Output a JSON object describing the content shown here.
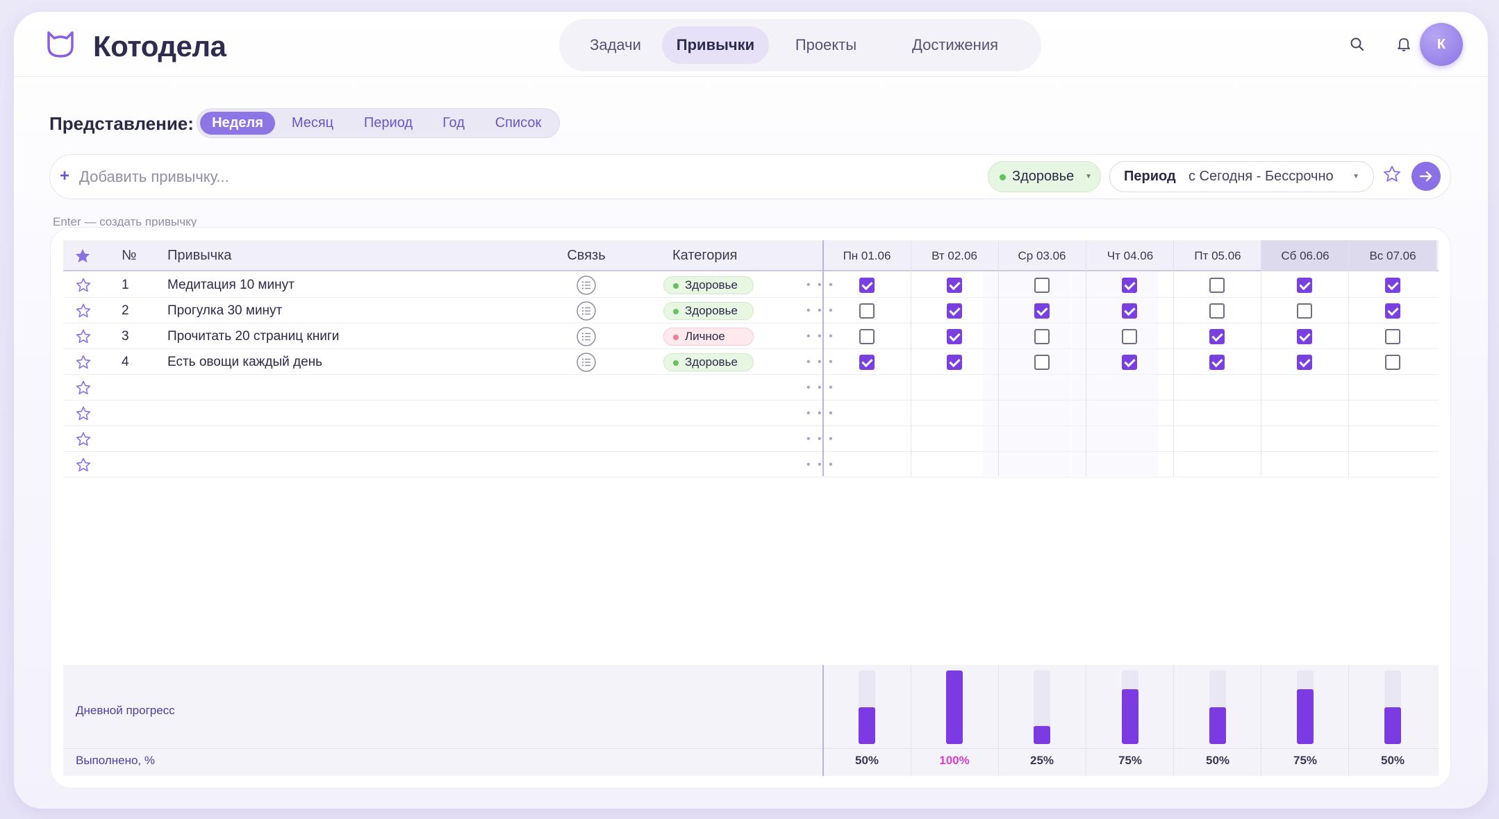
{
  "app": {
    "title": "Котодела"
  },
  "nav": [
    {
      "label": "Задачи",
      "active": false
    },
    {
      "label": "Привычки",
      "active": true
    },
    {
      "label": "Проекты",
      "active": false
    },
    {
      "label": "Достижения",
      "active": false
    }
  ],
  "header": {
    "avatar_initial": "К",
    "icons": [
      "search-icon",
      "bell-icon"
    ]
  },
  "view": {
    "label": "Представление:",
    "tabs": [
      {
        "label": "Неделя",
        "active": true
      },
      {
        "label": "Месяц",
        "active": false
      },
      {
        "label": "Период",
        "active": false
      },
      {
        "label": "Год",
        "active": false
      },
      {
        "label": "Список",
        "active": false
      }
    ]
  },
  "addbar": {
    "plus": "+",
    "placeholder": "Добавить привычку...",
    "category": "Здоровье",
    "period_label": "Период",
    "period_value": "с Сегодня - Бессрочно",
    "hint": "Enter — создать привычку"
  },
  "table": {
    "headers": {
      "num": "№",
      "habit": "Привычка",
      "link": "Связь",
      "category": "Категория"
    },
    "days": [
      {
        "label": "Пн 01.06",
        "weekend": false
      },
      {
        "label": "Вт 02.06",
        "weekend": false
      },
      {
        "label": "Ср 03.06",
        "weekend": false
      },
      {
        "label": "Чт 04.06",
        "weekend": false
      },
      {
        "label": "Пт 05.06",
        "weekend": false
      },
      {
        "label": "Сб 06.06",
        "weekend": true
      },
      {
        "label": "Вс 07.06",
        "weekend": true
      }
    ],
    "rows": [
      {
        "num": "1",
        "name": "Медитация 10 минут",
        "category": "Здоровье",
        "category_color": "green",
        "checks": [
          true,
          true,
          false,
          true,
          false,
          true,
          true
        ]
      },
      {
        "num": "2",
        "name": "Прогулка 30 минут",
        "category": "Здоровье",
        "category_color": "green",
        "checks": [
          false,
          true,
          true,
          true,
          false,
          false,
          true
        ]
      },
      {
        "num": "3",
        "name": "Прочитать 20 страниц книги",
        "category": "Личное",
        "category_color": "pink",
        "checks": [
          false,
          true,
          false,
          false,
          true,
          true,
          false
        ]
      },
      {
        "num": "4",
        "name": "Есть овощи каждый день",
        "category": "Здоровье",
        "category_color": "green",
        "checks": [
          true,
          true,
          false,
          true,
          true,
          true,
          false
        ]
      },
      {
        "num": "",
        "name": "",
        "category": "",
        "category_color": "",
        "checks": null
      },
      {
        "num": "",
        "name": "",
        "category": "",
        "category_color": "",
        "checks": null
      },
      {
        "num": "",
        "name": "",
        "category": "",
        "category_color": "",
        "checks": null
      },
      {
        "num": "",
        "name": "",
        "category": "",
        "category_color": "",
        "checks": null
      }
    ],
    "row_menu": "• • •"
  },
  "progress": {
    "label_daily": "Дневной прогресс",
    "label_done": "Выполнено, %",
    "values": [
      50,
      100,
      25,
      75,
      50,
      75,
      50
    ],
    "labels": [
      "50%",
      "100%",
      "25%",
      "75%",
      "50%",
      "75%",
      "50%"
    ]
  },
  "colors": {
    "accent": "#7c3ae3",
    "accent_light": "#8d75e6",
    "full_pct": "#d83ed0"
  }
}
